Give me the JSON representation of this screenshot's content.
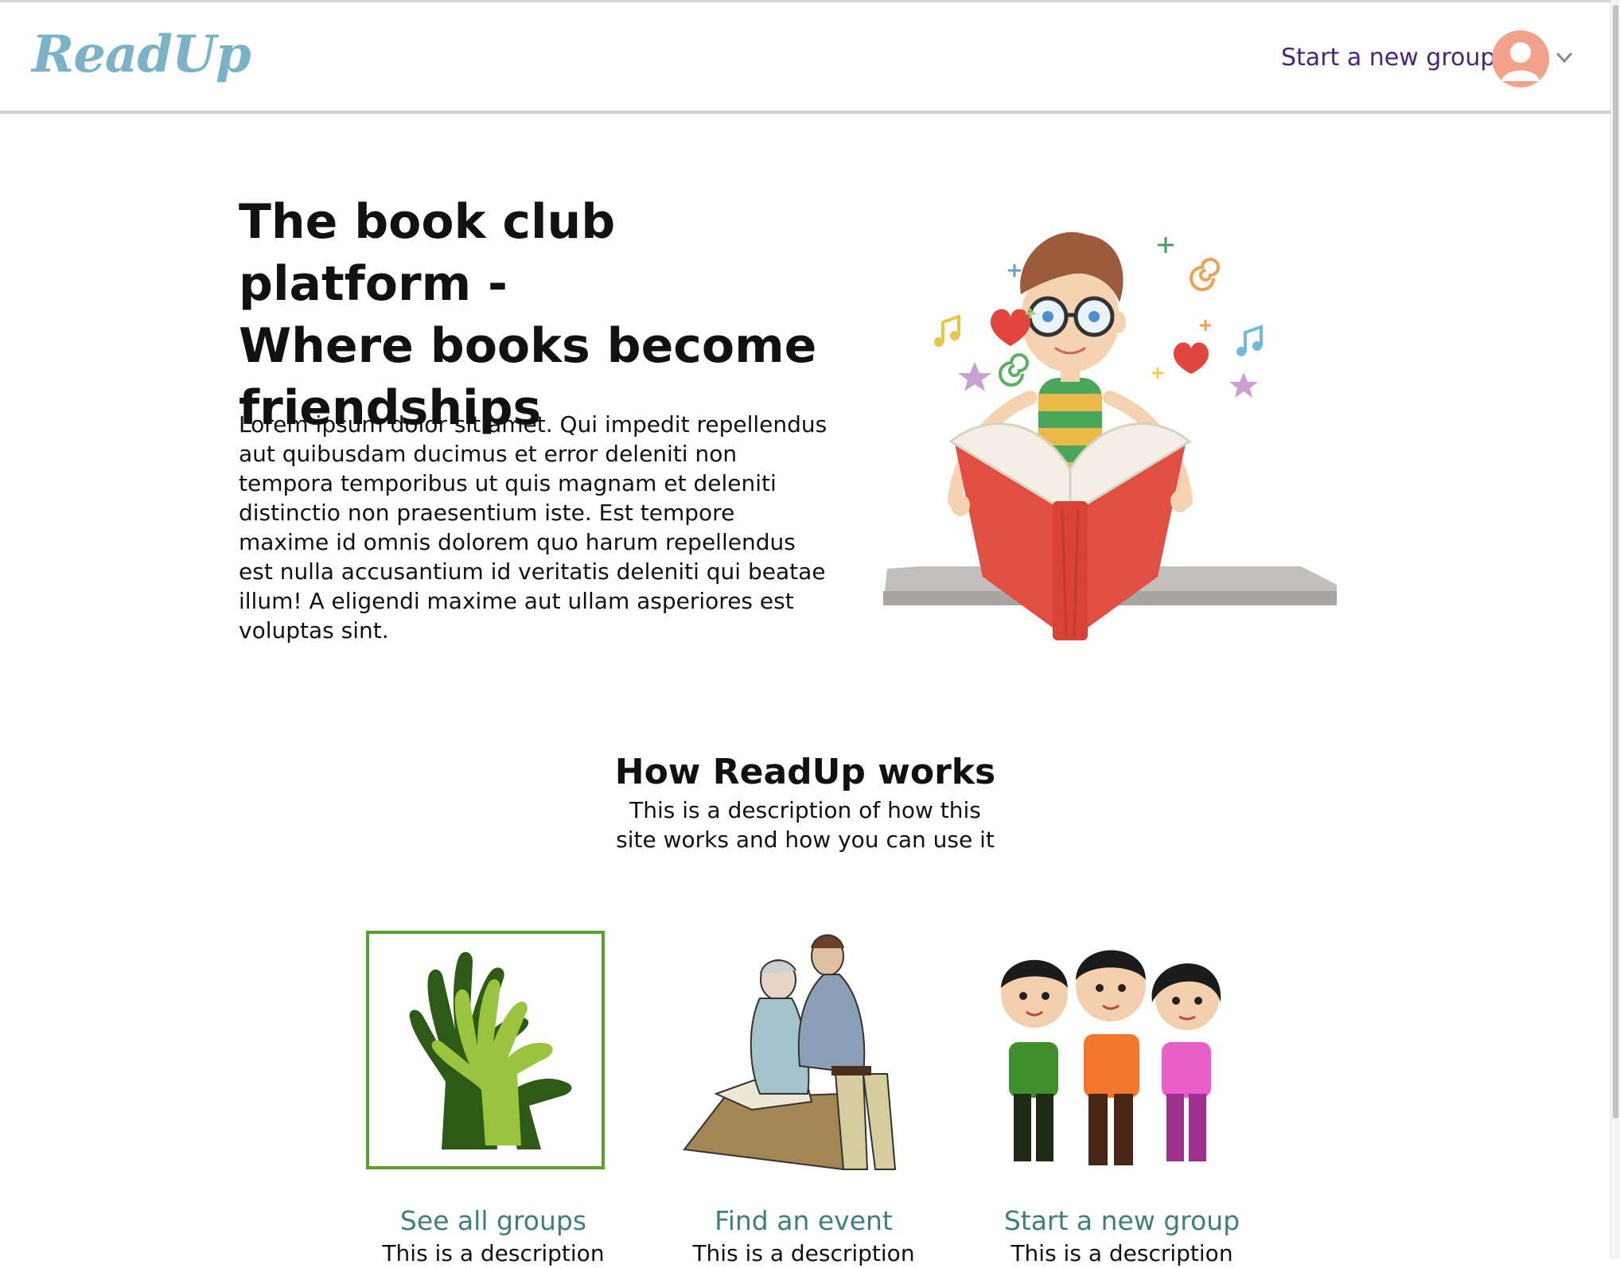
{
  "header": {
    "logo": "ReadUp",
    "nav_link": "Start a new group",
    "avatar_icon": "user-avatar-icon",
    "menu_icon": "chevron-down-icon"
  },
  "hero": {
    "title_line1": "The book club platform -",
    "title_line2": "Where books become",
    "title_line3": "friendships",
    "text": "Lorem ipsum dolor sit amet. Qui impedit repellendus aut quibusdam ducimus et error deleniti non tempora temporibus ut quis magnam et deleniti distinctio non praesentium iste. Est tempore maxime id omnis dolorem quo harum repellendus est nulla accusantium id veritatis deleniti qui beatae illum! A eligendi maxime aut ullam asperiores est voluptas sint."
  },
  "how": {
    "title": "How ReadUp works",
    "description": "This is a description of how this site works and how you can use it"
  },
  "cards": [
    {
      "title": "See all groups",
      "description": "This is a description"
    },
    {
      "title": "Find an event",
      "description": "This is a description"
    },
    {
      "title": "Start a new group",
      "description": "This is a description"
    }
  ],
  "colors": {
    "logo": "#7ab3c6",
    "nav_link": "#4a2580",
    "card_title": "#3d7f7e",
    "card_border": "#5aa02c",
    "avatar": "#f2a28b"
  }
}
